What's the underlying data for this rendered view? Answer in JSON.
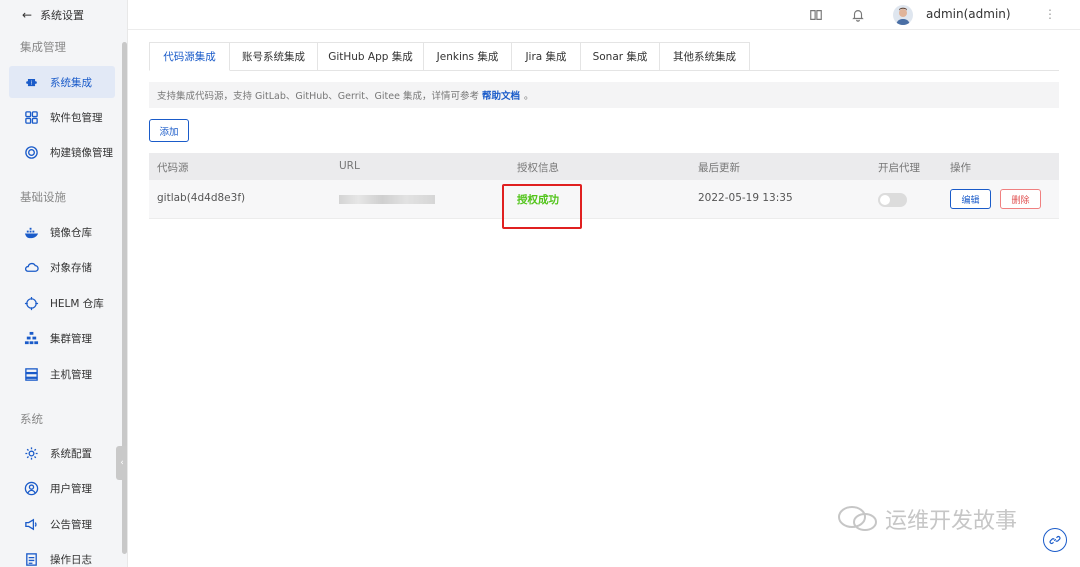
{
  "sidebar": {
    "back_label": "系统设置",
    "groups": [
      {
        "title": "集成管理",
        "items": [
          {
            "label": "系统集成",
            "icon": "command-icon",
            "active": true
          },
          {
            "label": "软件包管理",
            "icon": "grid-icon"
          },
          {
            "label": "构建镜像管理",
            "icon": "image-build-icon"
          }
        ]
      },
      {
        "title": "基础设施",
        "items": [
          {
            "label": "镜像仓库",
            "icon": "docker-icon"
          },
          {
            "label": "对象存储",
            "icon": "cloud-icon"
          },
          {
            "label": "HELM 仓库",
            "icon": "helm-icon"
          },
          {
            "label": "集群管理",
            "icon": "cluster-icon"
          },
          {
            "label": "主机管理",
            "icon": "server-icon"
          }
        ]
      },
      {
        "title": "系统",
        "items": [
          {
            "label": "系统配置",
            "icon": "settings-icon"
          },
          {
            "label": "用户管理",
            "icon": "user-icon"
          },
          {
            "label": "公告管理",
            "icon": "megaphone-icon"
          },
          {
            "label": "操作日志",
            "icon": "log-icon"
          }
        ]
      }
    ]
  },
  "header": {
    "user": "admin(admin)"
  },
  "tabs": [
    {
      "label": "代码源集成",
      "active": true
    },
    {
      "label": "账号系统集成"
    },
    {
      "label": "GitHub App 集成"
    },
    {
      "label": "Jenkins 集成"
    },
    {
      "label": "Jira 集成"
    },
    {
      "label": "Sonar 集成"
    },
    {
      "label": "其他系统集成"
    }
  ],
  "info": {
    "text": "支持集成代码源，支持 GitLab、GitHub、Gerrit、Gitee 集成，详情可参考",
    "link": "帮助文档",
    "suffix": "。"
  },
  "add_label": "添加",
  "table": {
    "headers": [
      "代码源",
      "URL",
      "授权信息",
      "最后更新",
      "开启代理",
      "操作"
    ],
    "rows": [
      {
        "source": "gitlab(4d4d8e3f)",
        "auth": "授权成功",
        "updated": "2022-05-19 13:35",
        "proxy": false
      }
    ],
    "edit_label": "编辑",
    "delete_label": "删除"
  },
  "watermark": "运维开发故事",
  "colors": {
    "primary": "#1a5bc9",
    "success": "#52c41a",
    "danger": "#e05050",
    "highlight": "#e02020"
  }
}
